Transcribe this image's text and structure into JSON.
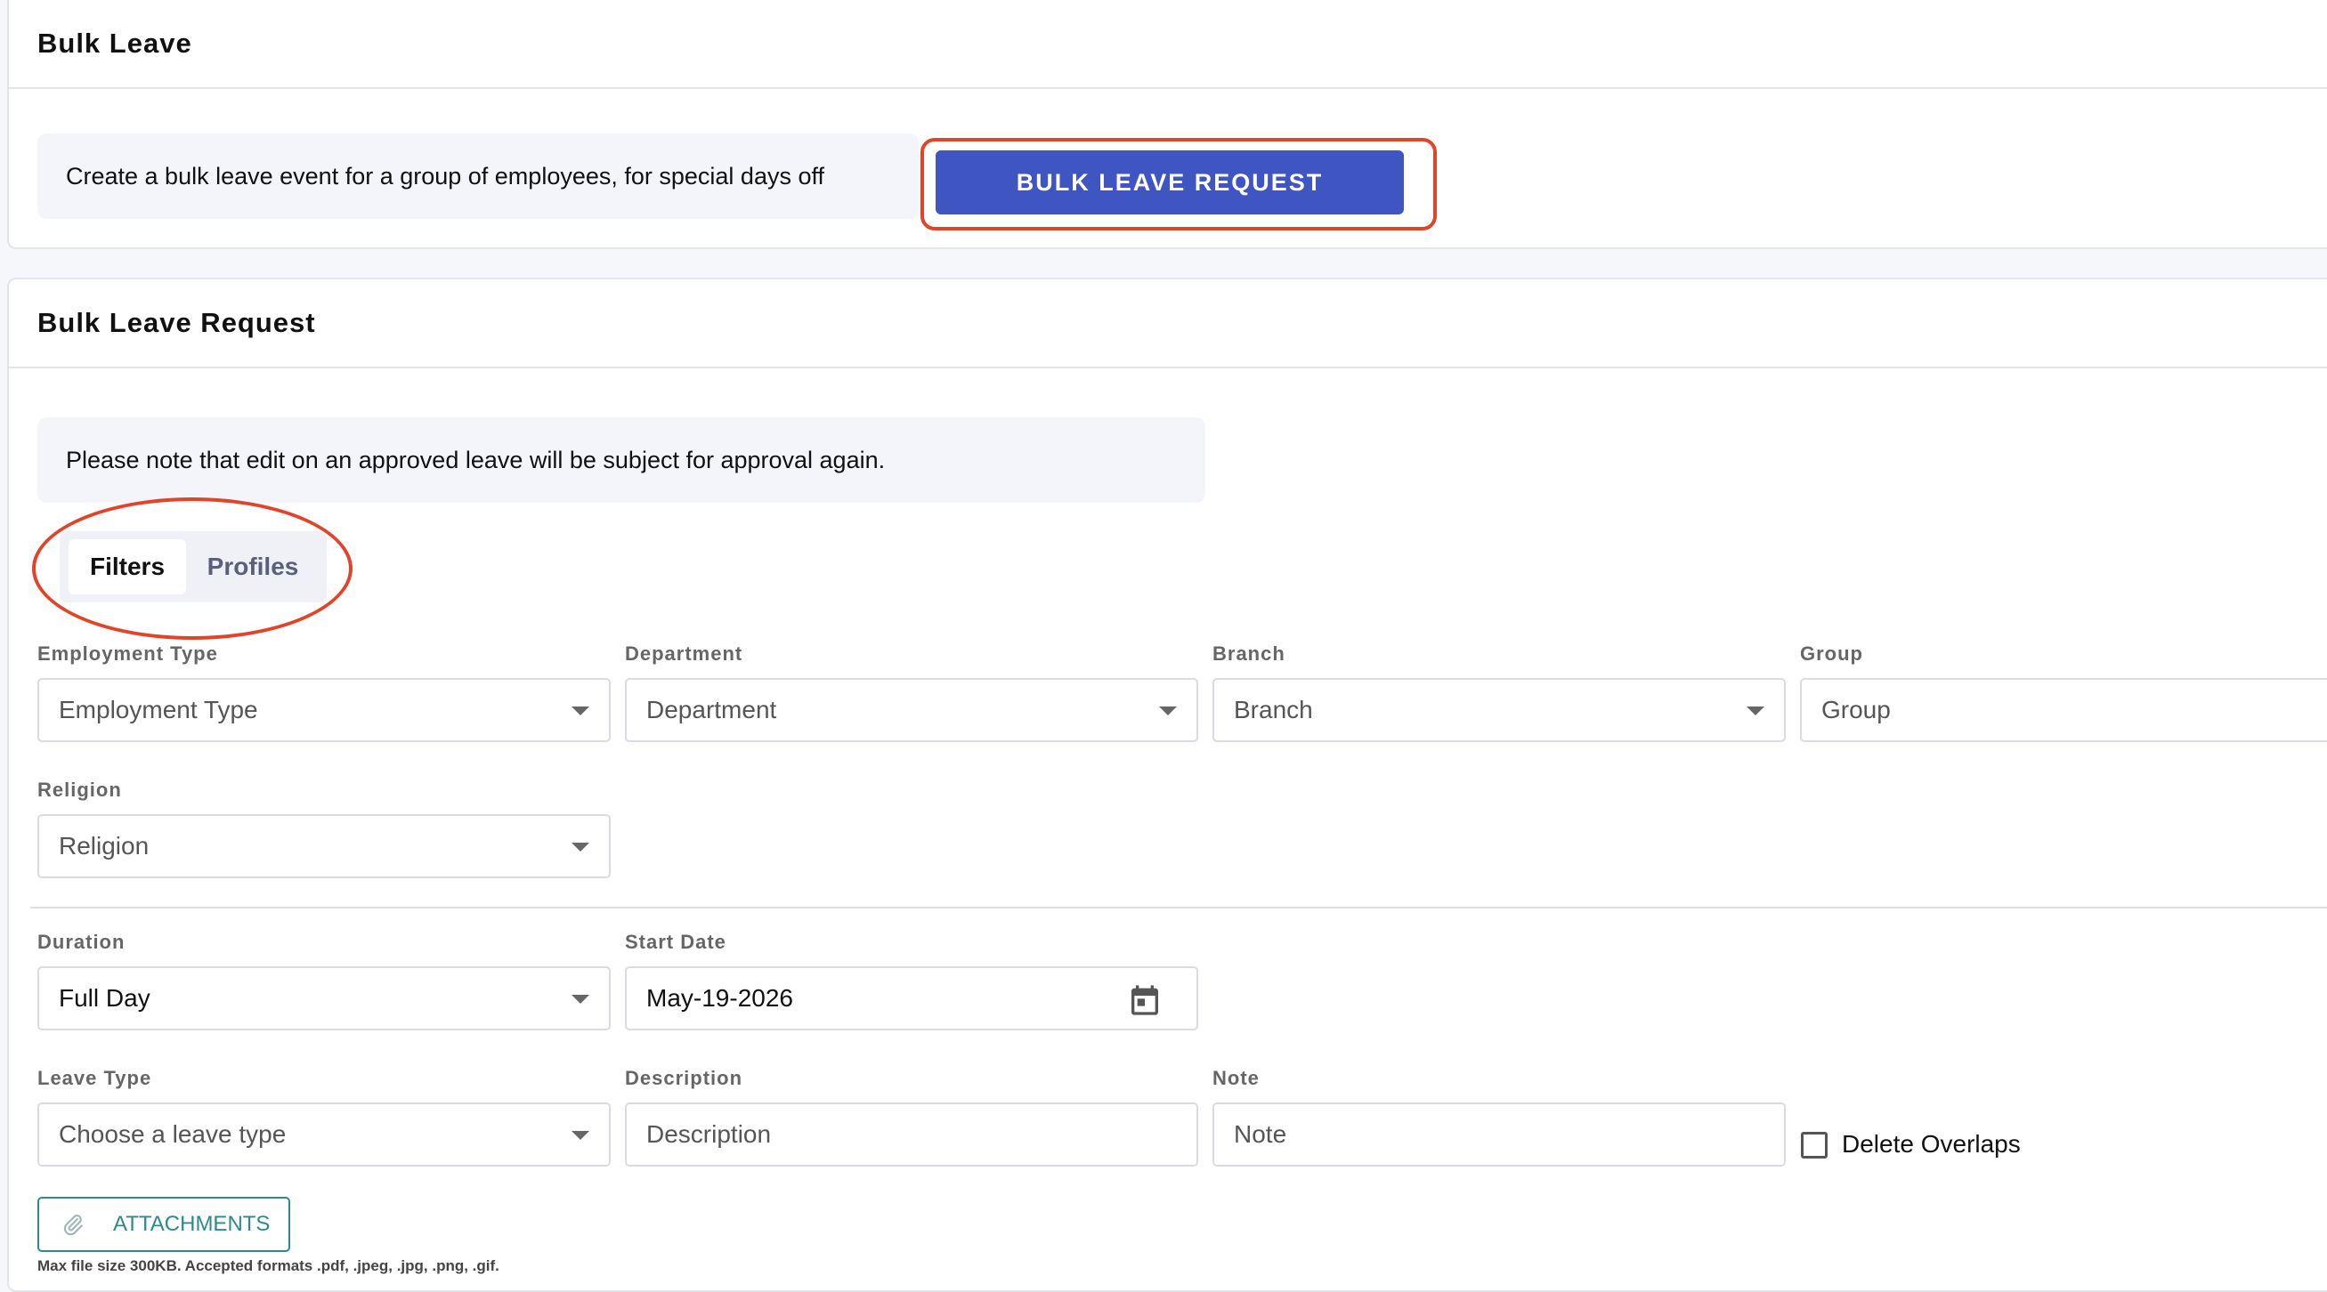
{
  "bulk_leave_card": {
    "title": "Bulk Leave",
    "info": "Create a bulk leave event for a group of employees, for special days off",
    "button_label": "BULK LEAVE REQUEST"
  },
  "request_card": {
    "title": "Bulk Leave Request",
    "notice": "Please note that edit on an approved leave will be subject for approval again.",
    "tabs": [
      {
        "label": "Filters",
        "active": true
      },
      {
        "label": "Profiles",
        "active": false
      }
    ],
    "filters": {
      "employment_type": {
        "label": "Employment Type",
        "placeholder": "Employment Type"
      },
      "department": {
        "label": "Department",
        "placeholder": "Department"
      },
      "branch": {
        "label": "Branch",
        "placeholder": "Branch"
      },
      "group": {
        "label": "Group",
        "placeholder": "Group"
      },
      "religion": {
        "label": "Religion",
        "placeholder": "Religion"
      }
    },
    "duration": {
      "label": "Duration",
      "value": "Full Day"
    },
    "start_date": {
      "label": "Start Date",
      "value": "May-19-2026"
    },
    "leave_type": {
      "label": "Leave Type",
      "placeholder": "Choose a leave type"
    },
    "description": {
      "label": "Description",
      "placeholder": "Description"
    },
    "note": {
      "label": "Note",
      "placeholder": "Note"
    },
    "delete_overlaps": {
      "label": "Delete Overlaps",
      "checked": false
    },
    "attachments": {
      "button_label": "ATTACHMENTS",
      "hint": "Max file size 300KB. Accepted formats .pdf, .jpeg, .jpg, .png, .gif."
    }
  },
  "colors": {
    "primary": "#3f55c1",
    "highlight": "#e0452b",
    "teal": "#2c8a8c"
  }
}
